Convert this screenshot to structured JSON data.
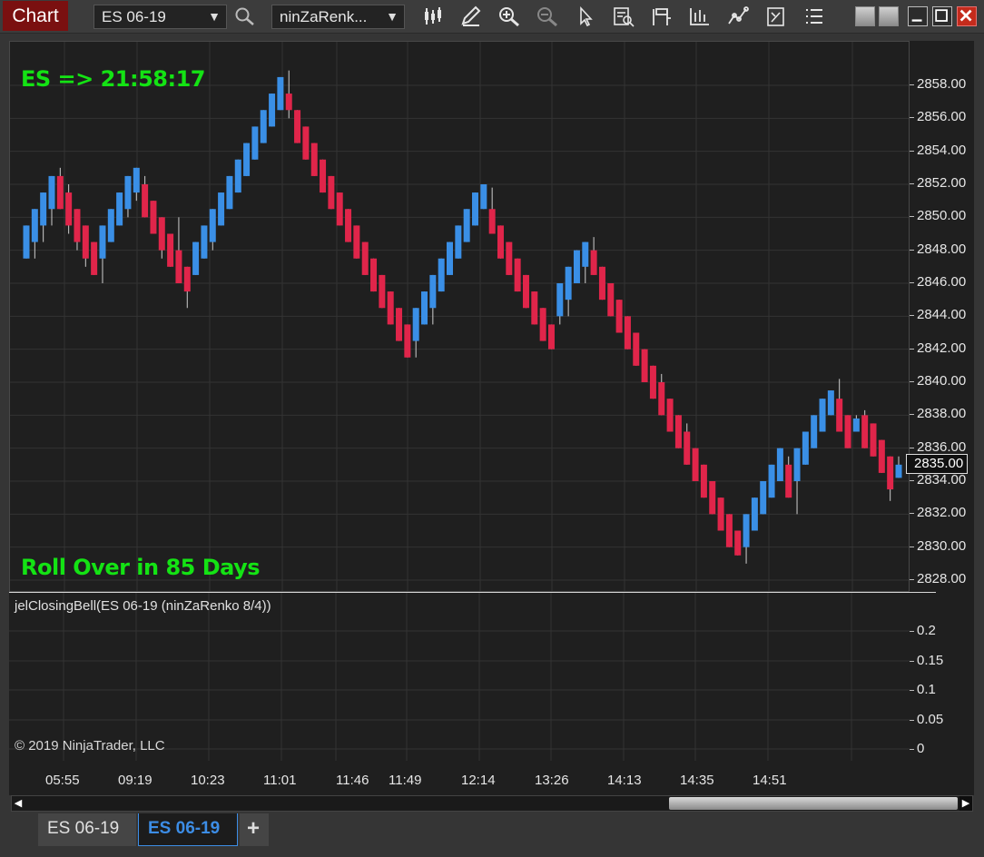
{
  "window": {
    "title": "Chart"
  },
  "toolbar": {
    "instrument": "ES 06-19",
    "bar_type": "ninZaRenk...",
    "icons": [
      "search-icon",
      "bar-type-icon",
      "drawing-tool-icon",
      "zoom-in-icon",
      "zoom-out-icon",
      "pointer-icon",
      "data-box-icon",
      "properties-icon",
      "indicators-icon",
      "strategies-icon",
      "chart-trader-icon",
      "list-icon"
    ]
  },
  "overlay": {
    "countdown": "ES => 21:58:17",
    "rollover": "Roll Over in 85 Days",
    "text_color": "#14e314"
  },
  "indicator": {
    "label": "jelClosingBell(ES 06-19 (ninZaRenko 8/4))",
    "copyright": "© 2019 NinjaTrader, LLC"
  },
  "colors": {
    "up": "#3a8fe6",
    "down": "#e0254a",
    "background": "#1f1f1f",
    "grid": "#333333"
  },
  "chart_data": {
    "type": "candlestick",
    "instrument": "ES 06-19",
    "price_axis": {
      "labels": [
        "2858.00",
        "2856.00",
        "2854.00",
        "2852.00",
        "2850.00",
        "2848.00",
        "2846.00",
        "2844.00",
        "2842.00",
        "2840.00",
        "2838.00",
        "2836.00",
        "2834.00",
        "2832.00",
        "2830.00",
        "2828.00"
      ],
      "last_price": "2835.00"
    },
    "indicator_axis": {
      "labels": [
        "0.2",
        "0.15",
        "0.1",
        "0.05",
        "0"
      ]
    },
    "time_labels": [
      "05:55",
      "09:19",
      "10:23",
      "11:01",
      "11:46",
      "11:49",
      "12:14",
      "13:26",
      "14:13",
      "14:35",
      "14:51"
    ],
    "bricks": [
      {
        "o": 2847.5,
        "c": 2849.5,
        "h": 2849.5,
        "l": 2847.5
      },
      {
        "o": 2848.5,
        "c": 2850.5,
        "h": 2850.5,
        "l": 2847.5
      },
      {
        "o": 2849.5,
        "c": 2851.5,
        "h": 2851.5,
        "l": 2848.5
      },
      {
        "o": 2850.5,
        "c": 2852.5,
        "h": 2852.5,
        "l": 2849.5
      },
      {
        "o": 2852.5,
        "c": 2850.5,
        "h": 2853.0,
        "l": 2850.5
      },
      {
        "o": 2851.5,
        "c": 2849.5,
        "h": 2852.0,
        "l": 2849.0
      },
      {
        "o": 2850.5,
        "c": 2848.5,
        "h": 2850.5,
        "l": 2848.0
      },
      {
        "o": 2849.5,
        "c": 2847.5,
        "h": 2849.5,
        "l": 2847.0
      },
      {
        "o": 2848.5,
        "c": 2846.5,
        "h": 2848.5,
        "l": 2846.5
      },
      {
        "o": 2847.5,
        "c": 2849.5,
        "h": 2849.5,
        "l": 2846.0
      },
      {
        "o": 2848.5,
        "c": 2850.5,
        "h": 2850.5,
        "l": 2848.5
      },
      {
        "o": 2849.5,
        "c": 2851.5,
        "h": 2851.5,
        "l": 2849.5
      },
      {
        "o": 2850.5,
        "c": 2852.5,
        "h": 2852.5,
        "l": 2850.0
      },
      {
        "o": 2851.5,
        "c": 2853.0,
        "h": 2853.0,
        "l": 2851.0
      },
      {
        "o": 2852.0,
        "c": 2850.0,
        "h": 2852.5,
        "l": 2850.0
      },
      {
        "o": 2851.0,
        "c": 2849.0,
        "h": 2851.0,
        "l": 2849.0
      },
      {
        "o": 2850.0,
        "c": 2848.0,
        "h": 2850.0,
        "l": 2847.5
      },
      {
        "o": 2849.0,
        "c": 2847.0,
        "h": 2849.0,
        "l": 2847.0
      },
      {
        "o": 2848.0,
        "c": 2846.0,
        "h": 2850.0,
        "l": 2846.0
      },
      {
        "o": 2847.0,
        "c": 2845.5,
        "h": 2847.0,
        "l": 2844.5
      },
      {
        "o": 2846.5,
        "c": 2848.5,
        "h": 2848.5,
        "l": 2846.5
      },
      {
        "o": 2847.5,
        "c": 2849.5,
        "h": 2849.5,
        "l": 2847.5
      },
      {
        "o": 2848.5,
        "c": 2850.5,
        "h": 2850.5,
        "l": 2848.0
      },
      {
        "o": 2849.5,
        "c": 2851.5,
        "h": 2851.5,
        "l": 2849.5
      },
      {
        "o": 2850.5,
        "c": 2852.5,
        "h": 2852.5,
        "l": 2850.5
      },
      {
        "o": 2851.5,
        "c": 2853.5,
        "h": 2853.5,
        "l": 2851.5
      },
      {
        "o": 2852.5,
        "c": 2854.5,
        "h": 2854.5,
        "l": 2852.5
      },
      {
        "o": 2853.5,
        "c": 2855.5,
        "h": 2855.5,
        "l": 2853.5
      },
      {
        "o": 2854.5,
        "c": 2856.5,
        "h": 2856.5,
        "l": 2854.5
      },
      {
        "o": 2855.5,
        "c": 2857.5,
        "h": 2857.5,
        "l": 2855.5
      },
      {
        "o": 2856.5,
        "c": 2858.5,
        "h": 2858.5,
        "l": 2856.5
      },
      {
        "o": 2857.5,
        "c": 2856.5,
        "h": 2858.9,
        "l": 2856.0
      },
      {
        "o": 2856.5,
        "c": 2854.5,
        "h": 2856.5,
        "l": 2854.5
      },
      {
        "o": 2855.5,
        "c": 2853.5,
        "h": 2855.5,
        "l": 2853.5
      },
      {
        "o": 2854.5,
        "c": 2852.5,
        "h": 2854.5,
        "l": 2852.5
      },
      {
        "o": 2853.5,
        "c": 2851.5,
        "h": 2853.5,
        "l": 2851.5
      },
      {
        "o": 2852.5,
        "c": 2850.5,
        "h": 2852.5,
        "l": 2850.5
      },
      {
        "o": 2851.5,
        "c": 2849.5,
        "h": 2851.5,
        "l": 2849.5
      },
      {
        "o": 2850.5,
        "c": 2848.5,
        "h": 2850.5,
        "l": 2848.5
      },
      {
        "o": 2849.5,
        "c": 2847.5,
        "h": 2849.5,
        "l": 2847.5
      },
      {
        "o": 2848.5,
        "c": 2846.5,
        "h": 2848.5,
        "l": 2846.5
      },
      {
        "o": 2847.5,
        "c": 2845.5,
        "h": 2847.5,
        "l": 2845.5
      },
      {
        "o": 2846.5,
        "c": 2844.5,
        "h": 2846.5,
        "l": 2844.5
      },
      {
        "o": 2845.5,
        "c": 2843.5,
        "h": 2845.5,
        "l": 2843.5
      },
      {
        "o": 2844.5,
        "c": 2842.5,
        "h": 2844.5,
        "l": 2842.5
      },
      {
        "o": 2843.5,
        "c": 2841.5,
        "h": 2843.5,
        "l": 2841.5
      },
      {
        "o": 2842.5,
        "c": 2844.5,
        "h": 2844.5,
        "l": 2841.5
      },
      {
        "o": 2843.5,
        "c": 2845.5,
        "h": 2845.5,
        "l": 2843.5
      },
      {
        "o": 2844.5,
        "c": 2846.5,
        "h": 2846.5,
        "l": 2843.5
      },
      {
        "o": 2845.5,
        "c": 2847.5,
        "h": 2847.5,
        "l": 2845.5
      },
      {
        "o": 2846.5,
        "c": 2848.5,
        "h": 2848.5,
        "l": 2846.5
      },
      {
        "o": 2847.5,
        "c": 2849.5,
        "h": 2849.5,
        "l": 2847.5
      },
      {
        "o": 2848.5,
        "c": 2850.5,
        "h": 2850.5,
        "l": 2848.5
      },
      {
        "o": 2849.5,
        "c": 2851.5,
        "h": 2851.5,
        "l": 2849.5
      },
      {
        "o": 2850.5,
        "c": 2852.0,
        "h": 2852.0,
        "l": 2850.5
      },
      {
        "o": 2850.5,
        "c": 2849.0,
        "h": 2851.8,
        "l": 2849.0
      },
      {
        "o": 2849.5,
        "c": 2847.5,
        "h": 2849.5,
        "l": 2847.5
      },
      {
        "o": 2848.5,
        "c": 2846.5,
        "h": 2848.5,
        "l": 2846.5
      },
      {
        "o": 2847.5,
        "c": 2845.5,
        "h": 2847.5,
        "l": 2845.5
      },
      {
        "o": 2846.5,
        "c": 2844.5,
        "h": 2846.5,
        "l": 2844.5
      },
      {
        "o": 2845.5,
        "c": 2843.5,
        "h": 2845.5,
        "l": 2843.5
      },
      {
        "o": 2844.5,
        "c": 2842.5,
        "h": 2844.5,
        "l": 2842.5
      },
      {
        "o": 2843.5,
        "c": 2842.0,
        "h": 2843.5,
        "l": 2842.0
      },
      {
        "o": 2844.0,
        "c": 2846.0,
        "h": 2846.0,
        "l": 2843.5
      },
      {
        "o": 2845.0,
        "c": 2847.0,
        "h": 2847.0,
        "l": 2844.0
      },
      {
        "o": 2846.0,
        "c": 2848.0,
        "h": 2848.0,
        "l": 2846.0
      },
      {
        "o": 2847.0,
        "c": 2848.5,
        "h": 2848.5,
        "l": 2846.0
      },
      {
        "o": 2848.0,
        "c": 2846.5,
        "h": 2848.8,
        "l": 2846.5
      },
      {
        "o": 2847.0,
        "c": 2845.0,
        "h": 2847.0,
        "l": 2845.0
      },
      {
        "o": 2846.0,
        "c": 2844.0,
        "h": 2846.0,
        "l": 2844.0
      },
      {
        "o": 2845.0,
        "c": 2843.0,
        "h": 2845.0,
        "l": 2843.0
      },
      {
        "o": 2844.0,
        "c": 2842.0,
        "h": 2844.0,
        "l": 2842.0
      },
      {
        "o": 2843.0,
        "c": 2841.0,
        "h": 2843.0,
        "l": 2841.0
      },
      {
        "o": 2842.0,
        "c": 2840.0,
        "h": 2842.0,
        "l": 2840.0
      },
      {
        "o": 2841.0,
        "c": 2839.0,
        "h": 2841.0,
        "l": 2839.0
      },
      {
        "o": 2840.0,
        "c": 2838.0,
        "h": 2840.5,
        "l": 2838.0
      },
      {
        "o": 2839.0,
        "c": 2837.0,
        "h": 2839.0,
        "l": 2837.0
      },
      {
        "o": 2838.0,
        "c": 2836.0,
        "h": 2838.0,
        "l": 2836.0
      },
      {
        "o": 2837.0,
        "c": 2835.0,
        "h": 2837.5,
        "l": 2835.0
      },
      {
        "o": 2836.0,
        "c": 2834.0,
        "h": 2836.0,
        "l": 2834.0
      },
      {
        "o": 2835.0,
        "c": 2833.0,
        "h": 2835.0,
        "l": 2833.0
      },
      {
        "o": 2834.0,
        "c": 2832.0,
        "h": 2834.0,
        "l": 2832.0
      },
      {
        "o": 2833.0,
        "c": 2831.0,
        "h": 2833.0,
        "l": 2831.0
      },
      {
        "o": 2832.0,
        "c": 2830.0,
        "h": 2832.0,
        "l": 2830.0
      },
      {
        "o": 2831.0,
        "c": 2829.5,
        "h": 2831.0,
        "l": 2829.5
      },
      {
        "o": 2830.0,
        "c": 2832.0,
        "h": 2832.0,
        "l": 2829.0
      },
      {
        "o": 2831.0,
        "c": 2833.0,
        "h": 2833.0,
        "l": 2831.0
      },
      {
        "o": 2832.0,
        "c": 2834.0,
        "h": 2834.0,
        "l": 2832.0
      },
      {
        "o": 2833.0,
        "c": 2835.0,
        "h": 2835.0,
        "l": 2833.0
      },
      {
        "o": 2834.0,
        "c": 2836.0,
        "h": 2836.0,
        "l": 2834.0
      },
      {
        "o": 2835.0,
        "c": 2833.0,
        "h": 2835.5,
        "l": 2833.0
      },
      {
        "o": 2834.0,
        "c": 2836.0,
        "h": 2836.0,
        "l": 2832.0
      },
      {
        "o": 2835.0,
        "c": 2837.0,
        "h": 2837.0,
        "l": 2835.0
      },
      {
        "o": 2836.0,
        "c": 2838.0,
        "h": 2838.0,
        "l": 2836.0
      },
      {
        "o": 2837.0,
        "c": 2839.0,
        "h": 2839.0,
        "l": 2837.0
      },
      {
        "o": 2838.0,
        "c": 2839.5,
        "h": 2839.5,
        "l": 2838.0
      },
      {
        "o": 2839.0,
        "c": 2837.0,
        "h": 2840.2,
        "l": 2837.0
      },
      {
        "o": 2838.0,
        "c": 2836.0,
        "h": 2838.0,
        "l": 2836.0
      },
      {
        "o": 2837.0,
        "c": 2837.8,
        "h": 2838.0,
        "l": 2837.0
      },
      {
        "o": 2838.0,
        "c": 2836.0,
        "h": 2838.3,
        "l": 2836.0
      },
      {
        "o": 2837.5,
        "c": 2835.5,
        "h": 2837.5,
        "l": 2835.5
      },
      {
        "o": 2836.5,
        "c": 2834.5,
        "h": 2836.5,
        "l": 2834.5
      },
      {
        "o": 2835.5,
        "c": 2833.5,
        "h": 2835.5,
        "l": 2832.8
      },
      {
        "o": 2834.2,
        "c": 2835.0,
        "h": 2835.5,
        "l": 2834.2
      }
    ]
  },
  "scrollbar": {
    "left_arrow": "◀",
    "right_arrow": "▶"
  },
  "tabs": [
    {
      "label": "ES 06-19",
      "active": false
    },
    {
      "label": "ES 06-19",
      "active": true
    }
  ],
  "tab_add": "+"
}
